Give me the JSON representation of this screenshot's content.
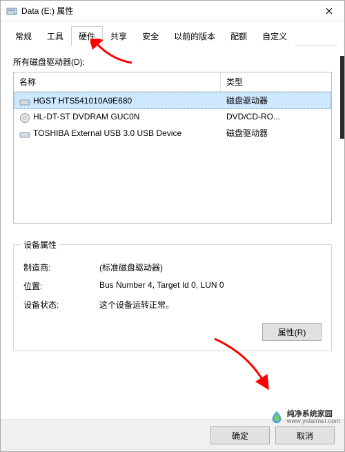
{
  "window": {
    "title": "Data (E:) 属性",
    "close_tooltip": "关闭"
  },
  "tabs": [
    {
      "label": "常规",
      "active": false
    },
    {
      "label": "工具",
      "active": false
    },
    {
      "label": "硬件",
      "active": true
    },
    {
      "label": "共享",
      "active": false
    },
    {
      "label": "安全",
      "active": false
    },
    {
      "label": "以前的版本",
      "active": false
    },
    {
      "label": "配额",
      "active": false
    },
    {
      "label": "自定义",
      "active": false
    }
  ],
  "hardware": {
    "list_label": "所有磁盘驱动器(D):",
    "columns": {
      "name": "名称",
      "type": "类型"
    },
    "rows": [
      {
        "icon": "hdd",
        "name": "HGST HTS541010A9E680",
        "type": "磁盘驱动器",
        "selected": true
      },
      {
        "icon": "cd",
        "name": "HL-DT-ST DVDRAM GUC0N",
        "type": "DVD/CD-RO...",
        "selected": false
      },
      {
        "icon": "hdd",
        "name": "TOSHIBA External USB 3.0 USB Device",
        "type": "磁盘驱动器",
        "selected": false
      }
    ],
    "group_title": "设备属性",
    "manufacturer_label": "制造商:",
    "manufacturer_value": "(标准磁盘驱动器)",
    "location_label": "位置:",
    "location_value": "Bus Number 4, Target Id 0, LUN 0",
    "status_label": "设备状态:",
    "status_value": "这个设备运转正常。",
    "properties_button": "属性(R)"
  },
  "dialog_buttons": {
    "ok": "确定",
    "cancel": "取消"
  },
  "watermark": {
    "line1": "纯净系统家园",
    "line2": "www.yidaimei.com"
  },
  "annotation": {
    "arrow_color": "#ff0000"
  }
}
